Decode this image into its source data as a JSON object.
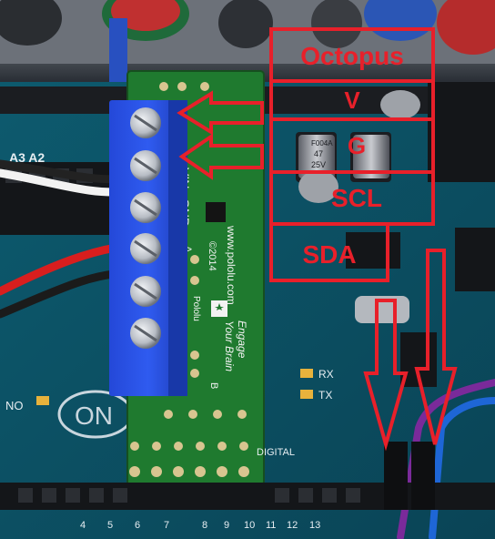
{
  "annotations": {
    "labels": [
      "Octopus",
      "V",
      "G",
      "SCL",
      "SDA"
    ],
    "color": "#e8202a"
  },
  "board_silkscreen": {
    "driver_pins": [
      "VIN",
      "GND"
    ],
    "brand": "www.pololu.com",
    "year": "©2014",
    "maker": "Pololu",
    "slogan_line1": "Engage",
    "slogan_line2": "Your Brain",
    "pin_a": "A",
    "pin_b": "B",
    "arduino_text": [
      "ON",
      "RX",
      "TX",
      "NO",
      "DIGITAL"
    ],
    "header_numbers": [
      "13",
      "12",
      "11",
      "10",
      "9",
      "8",
      "7",
      "6",
      "5",
      "4"
    ]
  },
  "capacitor_marking": [
    "F004A",
    "47",
    "25V"
  ]
}
